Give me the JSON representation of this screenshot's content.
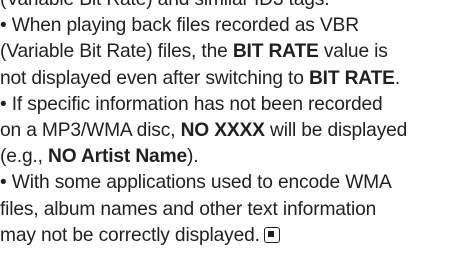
{
  "lines": [
    {
      "t1": "(Variable Bit Rate) and similar ID3 tags."
    },
    {
      "t1": "• When playing back files recorded as VBR"
    },
    {
      "t1": "(Variable Bit Rate) files, the ",
      "b1": "BIT RATE",
      "t2": " value is"
    },
    {
      "t1": "not displayed even after switching to ",
      "b1": "BIT RATE",
      "t2": "."
    },
    {
      "t1": "• If specific information has not been recorded"
    },
    {
      "t1": "on a MP3/WMA disc, ",
      "b1": "NO XXXX",
      "t2": " will be displayed"
    },
    {
      "t1": "(e.g., ",
      "b1": "NO Artist Name",
      "t2": ")."
    },
    {
      "t1": "• With some applications used to encode WMA"
    },
    {
      "t1": "files, album names and other text information"
    },
    {
      "t1": "may not be correctly displayed."
    }
  ],
  "end_icon": "stop-icon"
}
